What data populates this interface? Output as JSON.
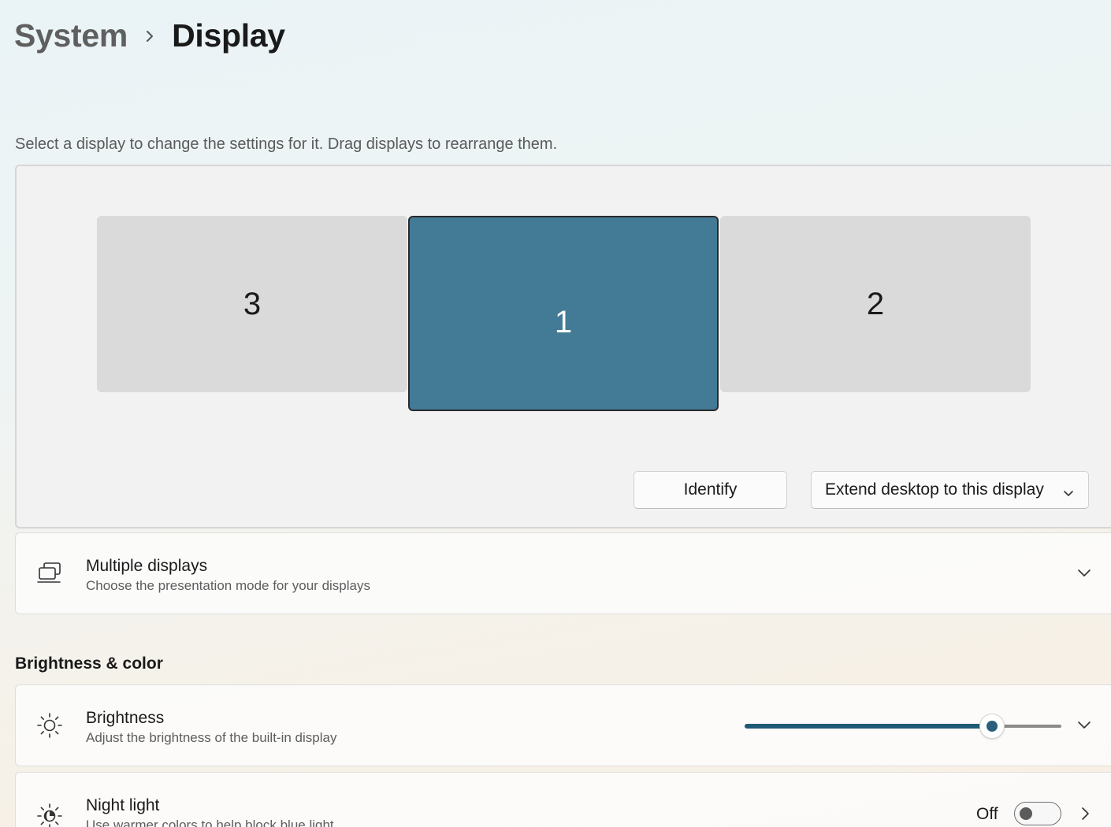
{
  "breadcrumb": {
    "parent": "System",
    "current": "Display"
  },
  "instruction": "Select a display to change the settings for it. Drag displays to rearrange them.",
  "monitors": [
    {
      "label": "3",
      "selected": false
    },
    {
      "label": "1",
      "selected": true
    },
    {
      "label": "2",
      "selected": false
    }
  ],
  "buttons": {
    "identify": "Identify",
    "extend": "Extend desktop to this display"
  },
  "multiple_displays": {
    "title": "Multiple displays",
    "description": "Choose the presentation mode for your displays"
  },
  "section_brightness": "Brightness & color",
  "brightness": {
    "title": "Brightness",
    "description": "Adjust the brightness of the built-in display",
    "value_percent": 78
  },
  "night_light": {
    "title": "Night light",
    "description": "Use warmer colors to help block blue light",
    "state": "Off"
  },
  "colors": {
    "accent": "#437a95",
    "slider_fill": "#215a76"
  },
  "icons": {
    "breadcrumb_separator": "chevron-right-icon",
    "multiple_displays": "multiple-displays-icon",
    "brightness": "sun-icon",
    "night_light": "night-light-icon",
    "expand": "chevron-down-icon",
    "navigate": "chevron-right-icon"
  }
}
